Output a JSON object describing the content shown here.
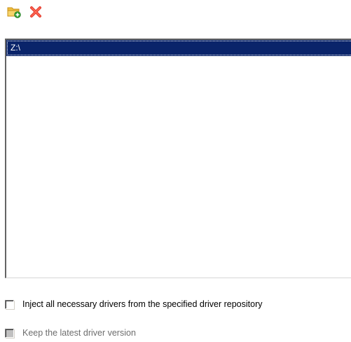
{
  "toolbar": {
    "buttons": [
      {
        "icon": "add-folder-icon"
      },
      {
        "icon": "delete-icon"
      }
    ]
  },
  "paths": {
    "items": [
      {
        "label": "Z:\\",
        "selected": true
      }
    ]
  },
  "options": {
    "inject_label": "Inject all necessary drivers from the specified driver repository",
    "inject_checked": false,
    "keep_latest_label": "Keep the latest driver version",
    "keep_latest_checked": false,
    "keep_latest_enabled": false
  },
  "colors": {
    "selection": "#0a246a",
    "disabled_text": "#6d6d6d"
  }
}
